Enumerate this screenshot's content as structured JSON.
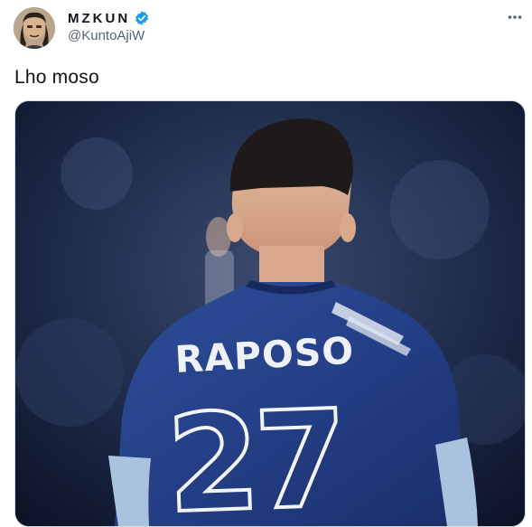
{
  "tweet": {
    "author": {
      "display_name": "MZKUN",
      "handle": "@KuntoAjiW",
      "verified": true,
      "avatar_icon": "avatar-photo",
      "verified_icon": "verified-badge-icon"
    },
    "more_icon": "more-horizontal-icon",
    "text": "Lho moso",
    "media": {
      "jersey_name": "RAPOSO",
      "jersey_number": "27"
    }
  },
  "colors": {
    "verified_blue": "#1d9bf0",
    "text_primary": "#0f1419",
    "text_secondary": "#536471",
    "jersey_navy": "#243f86"
  }
}
